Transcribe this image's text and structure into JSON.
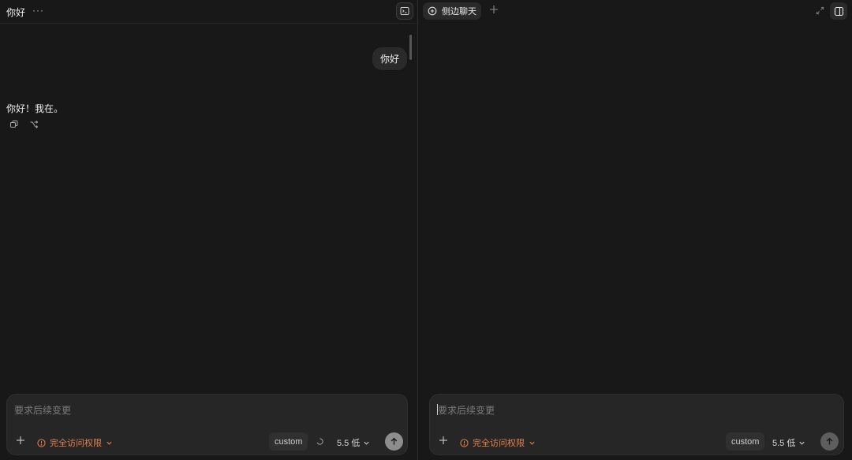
{
  "left": {
    "header": {
      "title": "你好",
      "more_label": "···"
    },
    "messages": {
      "user": "你好",
      "assistant": "你好！我在。"
    },
    "composer": {
      "placeholder": "要求后续变更",
      "access_label": "完全访问权限",
      "chip_label": "custom",
      "model_label": "5.5 低"
    }
  },
  "right": {
    "tab": {
      "label": "侧边聊天"
    },
    "composer": {
      "placeholder": "要求后续变更",
      "access_label": "完全访问权限",
      "chip_label": "custom",
      "model_label": "5.5 低"
    }
  },
  "colors": {
    "background": "#181818",
    "accent_warning": "#e6834e",
    "composer": "#262626"
  },
  "icons": [
    "more-icon",
    "terminal-icon",
    "copy-icon",
    "fork-icon",
    "plus-icon",
    "warning-icon",
    "chevron-down-icon",
    "spinner-icon",
    "send-arrow-icon",
    "chat-add-icon",
    "expand-icon",
    "sidebar-panel-icon"
  ]
}
